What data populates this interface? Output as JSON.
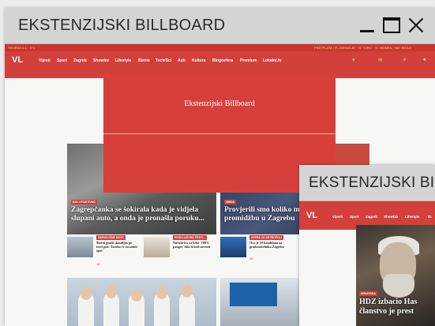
{
  "window1": {
    "title": "EKSTENZIJSKI BILLBOARD",
    "topline_left": "SRIJEDA 4.4.   ·   0°C",
    "topline_right": "PRETPLATA   |   VL ZDRAVLJE   ·   VL TOPIC   ·   VL WOMEN   ·   NATJEČAJI",
    "logo": "VL",
    "nav": [
      "Vijesti",
      "Sport",
      "Zagreb",
      "Showbiz",
      "Lifestyle",
      "Biznis",
      "Tech/Sci",
      "Auti",
      "Kultura",
      "Blogosfera",
      "Premium",
      "Lokalni.hr"
    ],
    "billboard_text": "Ekstenzijski Billboard",
    "hero_left": {
      "tag": "BAL I POZITIVNO",
      "headline": "Zagrepčanka se šokirala kada je vidjela slupani auto, a onda je pronašla poruku..."
    },
    "hero_right": {
      "tag": "ZIMNA",
      "headline": "Provjerili smo koliko morati posegnuti u d promidžbu u Zagrebu"
    },
    "small_items": [
      {
        "tag": "SIMBOLIČNE MOST",
        "text": "Slavni grafit skinuljen po treći put: 'Izneko će osvanuti opet'",
        "count": "10"
      },
      {
        "tag": "EKSKLUZIVNO PESTI...",
        "text": "Naruširica za bebe '100% panger' bila bi ind-suvenir",
        "count": ""
      },
      {
        "tag": "AFERA ZA ARTROPOLI",
        "text": "Ovo je 10 kandidata za gradonačelnika Zagreba",
        "count": "28"
      }
    ]
  },
  "window2": {
    "title": "EKSTENZIJSKI BILLBOARD",
    "logo": "VL",
    "nav": [
      "Vijesti",
      "Sport",
      "Zagreb",
      "Showbiz",
      "Lifestyle",
      "Bi"
    ],
    "hero_tag": "HRVATSKA",
    "hero_headline_1": "HDZ izbacio Has",
    "hero_headline_2": "članstvo je prest"
  },
  "colors": {
    "brand_red": "#d33f3a",
    "titlebar": "#d4d4d4"
  },
  "icons": [
    "minimize-icon",
    "maximize-icon",
    "close-icon",
    "weather-icon",
    "search-icon",
    "user-icon",
    "comment-icon"
  ]
}
